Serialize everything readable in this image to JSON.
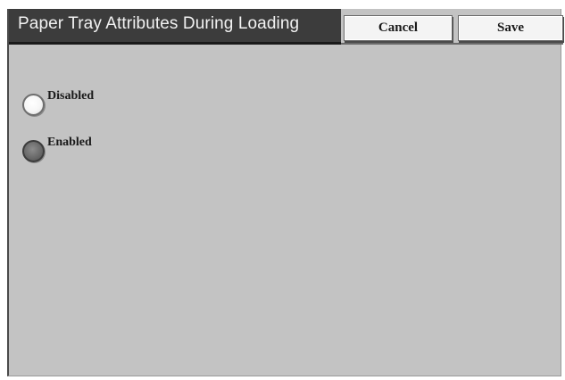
{
  "header": {
    "title": "Paper Tray Attributes During Loading",
    "cancel_label": "Cancel",
    "save_label": "Save"
  },
  "options": [
    {
      "label": "Disabled",
      "selected": false
    },
    {
      "label": "Enabled",
      "selected": true
    }
  ],
  "colors": {
    "panel_background": "#c3c3c3",
    "titlebar_background": "#3c3c3c",
    "button_background": "#f4f4f4",
    "radio_selected": "#6a6a6a",
    "radio_unselected": "#f6f6f6"
  }
}
